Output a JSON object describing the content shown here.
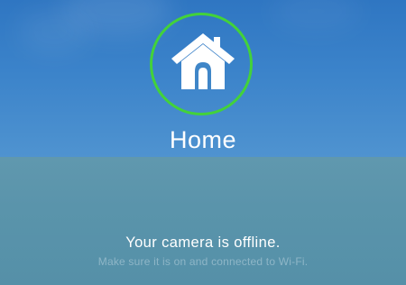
{
  "home": {
    "title": "Home",
    "icon": "home-icon",
    "ring_color": "#43d23a"
  },
  "status": {
    "message": "Your camera is offline.",
    "hint": "Make sure it is on and connected to Wi-Fi."
  }
}
